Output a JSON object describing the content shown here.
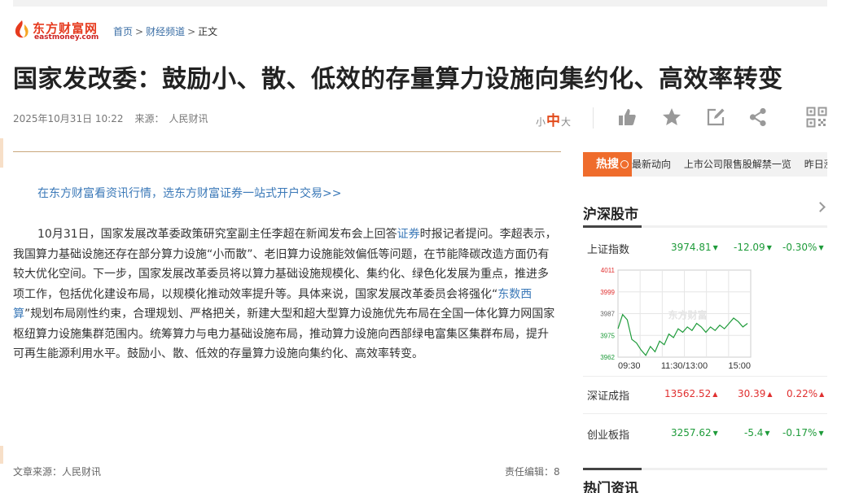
{
  "logo": {
    "cn": "东方财富网",
    "en": "eastmoney.com"
  },
  "breadcrumb": {
    "home": "首页",
    "separator": ">",
    "channel": "财经频道",
    "current": "正文"
  },
  "article": {
    "title": "国家发改委：鼓励小、散、低效的存量算力设施向集约化、高效率转变",
    "datetime": "2025年10月31日 10:22",
    "source_label": "来源：",
    "source": "人民财讯",
    "promo": "在东方财富看资讯行情，选东方财富证券一站式开户交易>>",
    "body": {
      "p1": "10月31日，国家发展改革委政策研究室副主任李超在新闻发布会上回答",
      "link1": "证券",
      "p2": "时报记者提问。李超表示，我国算力基础设施还存在部分算力设施“小而散”、老旧算力设施能效偏低等问题，在节能降碳改造方面仍有较大优化空间。下一步，国家发展改革委员将以算力基础设施规模化、集约化、绿色化发展为重点，推进多项工作，包括优化建设布局，以规模化推动效率提升等。具体来说，国家发展改革委员会将强化“",
      "link2": "东数西算",
      "p3": "”规划布局刚性约束，合理规划、严格把关，新建大型和超大型算力设施优先布局在全国一体化算力网国家枢纽算力设施集群范围内。统筹算力与电力基础设施布局，推动算力设施向西部绿电富集区集群布局，提升可再生能源利用水平。鼓励小、散、低效的存量算力设施向集约化、高效率转变。"
    },
    "footer_source": "文章来源：人民财讯",
    "footer_editor": "责任编辑：8"
  },
  "font_size": {
    "small": "小",
    "medium": "中",
    "large": "大"
  },
  "toolbar": {
    "icons": [
      "thumbs-up-icon",
      "star-icon",
      "edit-icon",
      "share-icon",
      "qrcode-icon"
    ]
  },
  "hot_search": {
    "tag": "热搜",
    "items": [
      "最新动向",
      "上市公司限售股解禁一览",
      "昨日涨停"
    ]
  },
  "market": {
    "title": "沪深股市",
    "indices": [
      {
        "name": "上证指数",
        "value": "3974.81",
        "change": "-12.09",
        "pct": "-0.30%",
        "dir": "down"
      },
      {
        "name": "深证成指",
        "value": "13562.52",
        "change": "30.39",
        "pct": "0.22%",
        "dir": "up"
      },
      {
        "name": "创业板指",
        "value": "3257.62",
        "change": "-5.4",
        "pct": "-0.17%",
        "dir": "down"
      }
    ]
  },
  "chart_data": {
    "type": "line",
    "y_ticks": [
      "4011",
      "3999",
      "3987",
      "3975",
      "3962"
    ],
    "ylim": [
      3962,
      4011
    ],
    "x_ticks": [
      "09:30",
      "11:30/13:00",
      "15:00"
    ],
    "watermark": "东方财富",
    "series": [
      {
        "values": [
          3978,
          3986,
          3983,
          3972,
          3970,
          3966,
          3963,
          3968,
          3965,
          3971,
          3969,
          3975,
          3973,
          3978,
          3976,
          3979,
          3977,
          3981,
          3979,
          3976,
          3979,
          3977,
          3980,
          3978,
          3981,
          3984,
          3982,
          3979,
          3981
        ]
      }
    ]
  },
  "hot_news": {
    "title": "热门资讯"
  },
  "colors": {
    "accent": "#ef6c2c",
    "link": "#3b79b8",
    "up": "#e03030",
    "down": "#1e9b3a"
  }
}
